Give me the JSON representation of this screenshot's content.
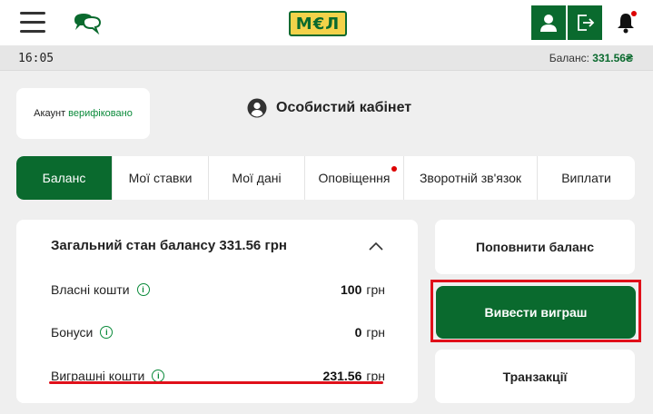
{
  "header": {
    "logo_text": "М€Л",
    "icons": [
      "menu-icon",
      "chat-icon",
      "user-icon",
      "logout-icon",
      "bell-icon"
    ]
  },
  "status": {
    "time": "16:05",
    "balance_label": "Баланс:",
    "balance_value": "331.56₴"
  },
  "account": {
    "prefix": "Акаунт",
    "status": "верифіковано"
  },
  "cabinet": {
    "title": "Особистий кабінет"
  },
  "tabs": [
    {
      "label": "Баланс",
      "active": true
    },
    {
      "label": "Мої ставки"
    },
    {
      "label": "Мої дані"
    },
    {
      "label": "Оповіщення",
      "has_notification": true
    },
    {
      "label": "Зворотній зв'язок"
    },
    {
      "label": "Виплати"
    }
  ],
  "balance": {
    "title": "Загальний стан балансу 331.56 грн",
    "rows": [
      {
        "label": "Власні кошти",
        "amount": "100",
        "currency": "грн"
      },
      {
        "label": "Бонуси",
        "amount": "0",
        "currency": "грн"
      },
      {
        "label": "Виграшні кошти",
        "amount": "231.56",
        "currency": "грн"
      }
    ]
  },
  "actions": {
    "topup": "Поповнити баланс",
    "withdraw": "Вивести виграш",
    "transactions": "Транзакції"
  },
  "colors": {
    "brand_green": "#0a6a2e",
    "highlight_red": "#e0101a",
    "logo_yellow": "#f3d24a"
  }
}
